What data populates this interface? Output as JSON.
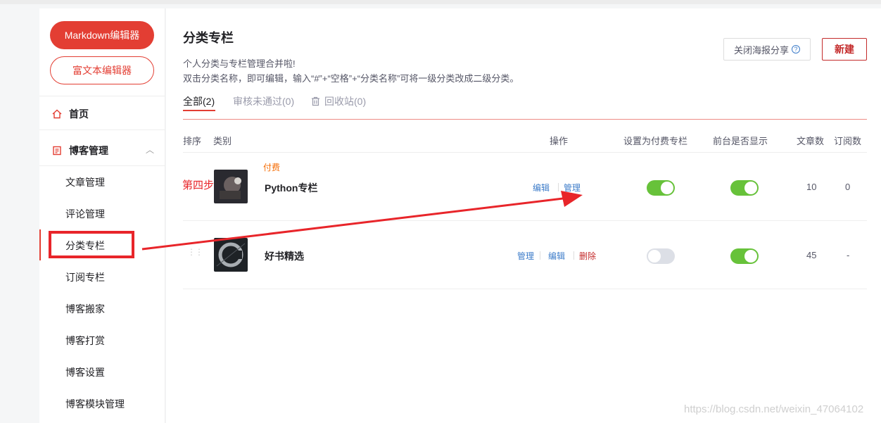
{
  "editor_buttons": {
    "markdown": "Markdown编辑器",
    "richtext": "富文本编辑器"
  },
  "nav": {
    "home": "首页",
    "blog_mgmt": "博客管理",
    "sub_items": [
      "文章管理",
      "评论管理",
      "分类专栏",
      "订阅专栏",
      "博客搬家",
      "博客打赏",
      "博客设置",
      "博客模块管理"
    ]
  },
  "header": {
    "title": "分类专栏",
    "desc_line1": "个人分类与专栏管理合并啦!",
    "desc_line2": "双击分类名称，即可编辑，输入“#”+“空格”+“分类名称”可将一级分类改成二级分类。",
    "share_button": "关闭海报分享",
    "new_button": "新建"
  },
  "tabs": [
    "全部(2)",
    "审核未通过(0)",
    "回收站(0)"
  ],
  "table": {
    "headers": {
      "sort": "排序",
      "category": "类别",
      "actions": "操作",
      "paid": "设置为付费专栏",
      "visible": "前台是否显示",
      "articles": "文章数",
      "subscribers": "订阅数"
    },
    "rows": [
      {
        "name": "Python专栏",
        "tag": "付费",
        "actions": [
          "编辑",
          "管理"
        ],
        "paid": true,
        "visible": true,
        "articles": "10",
        "subscribers": "0"
      },
      {
        "name": "好书精选",
        "tag": "",
        "actions": [
          "管理",
          "编辑",
          "删除"
        ],
        "paid": false,
        "visible": true,
        "articles": "45",
        "subscribers": "-"
      }
    ]
  },
  "annotation": {
    "step_label": "第四步",
    "color": "#e8252a"
  },
  "watermark": "https://blog.csdn.net/weixin_47064102",
  "colors": {
    "accent": "#e33e33",
    "link": "#3d7cc9",
    "toggle_on": "#67c23a",
    "paid_tag": "#f56a00"
  }
}
